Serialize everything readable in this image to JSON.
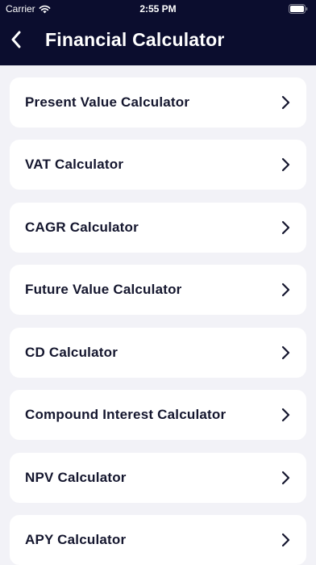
{
  "status_bar": {
    "carrier": "Carrier",
    "time": "2:55 PM",
    "icons": [
      "wifi-icon",
      "battery-icon"
    ]
  },
  "nav": {
    "title": "Financial Calculator",
    "back_icon": "chevron-left-icon"
  },
  "calculators": [
    {
      "label": "Present Value Calculator",
      "icon": "chevron-right-icon"
    },
    {
      "label": "VAT Calculator",
      "icon": "chevron-right-icon"
    },
    {
      "label": "CAGR Calculator",
      "icon": "chevron-right-icon"
    },
    {
      "label": "Future Value Calculator",
      "icon": "chevron-right-icon"
    },
    {
      "label": "CD Calculator",
      "icon": "chevron-right-icon"
    },
    {
      "label": "Compound Interest Calculator",
      "icon": "chevron-right-icon"
    },
    {
      "label": "NPV Calculator",
      "icon": "chevron-right-icon"
    },
    {
      "label": "APY Calculator",
      "icon": "chevron-right-icon"
    }
  ],
  "colors": {
    "header_bg": "#0b0d2e",
    "page_bg": "#f2f2f7",
    "card_bg": "#ffffff",
    "text": "#14162e"
  }
}
